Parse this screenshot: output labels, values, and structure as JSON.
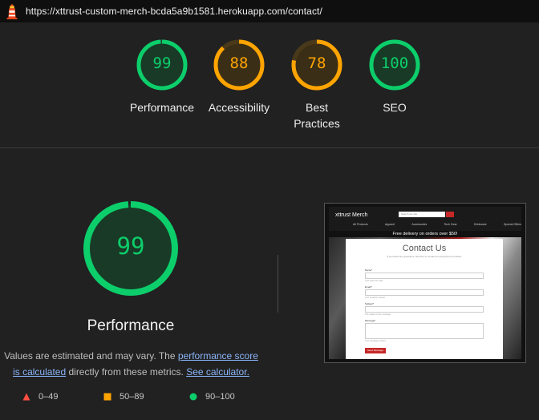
{
  "header": {
    "url": "https://xttrust-custom-merch-bcda5a9b1581.herokuapp.com/contact/"
  },
  "colors": {
    "pass": "#0cce6b",
    "average": "#ffa400",
    "fail": "#ff4e42",
    "link": "#8ab4f8"
  },
  "gauges": [
    {
      "score": "99",
      "label_line1": "Performance",
      "label_line2": "",
      "value": 99,
      "color": "#0cce6b"
    },
    {
      "score": "88",
      "label_line1": "Accessibility",
      "label_line2": "",
      "value": 88,
      "color": "#ffa400"
    },
    {
      "score": "78",
      "label_line1": "Best",
      "label_line2": "Practices",
      "value": 78,
      "color": "#ffa400"
    },
    {
      "score": "100",
      "label_line1": "SEO",
      "label_line2": "",
      "value": 100,
      "color": "#0cce6b"
    }
  ],
  "main": {
    "score": "99",
    "value": 99,
    "title": "Performance",
    "note_prefix": "Values are estimated and may vary. The ",
    "note_link1": "performance score is calculated",
    "note_middle": " directly from these metrics. ",
    "note_link2": "See calculator."
  },
  "legend": [
    {
      "icon": "triangle-icon",
      "text": "0–49"
    },
    {
      "icon": "square-icon",
      "text": "50–89"
    },
    {
      "icon": "circle-icon",
      "text": "90–100"
    }
  ],
  "thumbnail": {
    "brand": "xttrust Merch",
    "search_placeholder": "Search our site",
    "menu": [
      "All Products",
      "Apparel",
      "Accessories",
      "Tech Gear",
      "Drinkware",
      "Special Offers"
    ],
    "promo": "Free delivery on orders over $50!",
    "title": "Contact Us",
    "subtitle": "If you have any questions, feel free to contact us using the form below.",
    "fields": [
      {
        "label": "Name*",
        "help": "Your name for reply"
      },
      {
        "label": "Email*",
        "help": "Your email for contact"
      },
      {
        "label": "Subject*",
        "help": "The subject of the message"
      },
      {
        "label": "Message*",
        "help": "Your message content"
      }
    ],
    "button": "Send Message"
  }
}
